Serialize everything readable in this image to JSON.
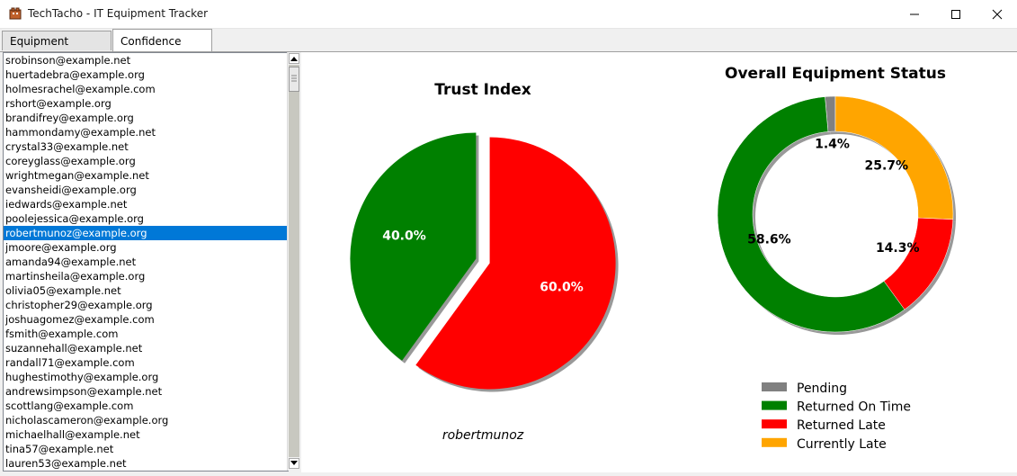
{
  "window": {
    "title": "TechTacho - IT Equipment Tracker",
    "minimize_icon": "minimize-icon",
    "maximize_icon": "maximize-icon",
    "close_icon": "close-icon"
  },
  "tabs": [
    {
      "label": "Equipment Tracking",
      "active": false
    },
    {
      "label": "Confidence Index",
      "active": true
    }
  ],
  "user_list": {
    "selected": "robertmunoz@example.org",
    "items": [
      "srobinson@example.net",
      "huertadebra@example.org",
      "holmesrachel@example.com",
      "rshort@example.org",
      "brandifrey@example.org",
      "hammondamy@example.net",
      "crystal33@example.net",
      "coreyglass@example.org",
      "wrightmegan@example.net",
      "evansheidi@example.org",
      "iedwards@example.net",
      "poolejessica@example.org",
      "robertmunoz@example.org",
      "jmoore@example.org",
      "amanda94@example.net",
      "martinsheila@example.org",
      "olivia05@example.net",
      "christopher29@example.org",
      "joshuagomez@example.com",
      "fsmith@example.com",
      "suzannehall@example.net",
      "randall71@example.com",
      "hughestimothy@example.org",
      "andrewsimpson@example.net",
      "scottlang@example.com",
      "nicholascameron@example.org",
      "michaelhall@example.net",
      "tina57@example.net",
      "lauren53@example.net"
    ]
  },
  "colors": {
    "green": "#008000",
    "red": "#ff0000",
    "orange": "#ffa500",
    "gray": "#808080",
    "selection": "#0078d7"
  },
  "chart_data": [
    {
      "type": "pie",
      "title": "Trust Index",
      "caption": "robertmunoz",
      "slices": [
        {
          "value": 40.0,
          "label": "40.0%",
          "color": "#008000"
        },
        {
          "value": 60.0,
          "label": "60.0%",
          "color": "#ff0000"
        }
      ]
    },
    {
      "type": "pie",
      "style": "donut",
      "title": "Overall Equipment Status",
      "slices": [
        {
          "name": "Pending",
          "value": 1.4,
          "label": "1.4%",
          "color": "#808080"
        },
        {
          "name": "Returned On Time",
          "value": 58.6,
          "label": "58.6%",
          "color": "#008000"
        },
        {
          "name": "Returned Late",
          "value": 14.3,
          "label": "14.3%",
          "color": "#ff0000"
        },
        {
          "name": "Currently Late",
          "value": 25.7,
          "label": "25.7%",
          "color": "#ffa500"
        }
      ],
      "legend": {
        "position": "bottom-right",
        "entries": [
          "Pending",
          "Returned On Time",
          "Returned Late",
          "Currently Late"
        ]
      }
    }
  ]
}
